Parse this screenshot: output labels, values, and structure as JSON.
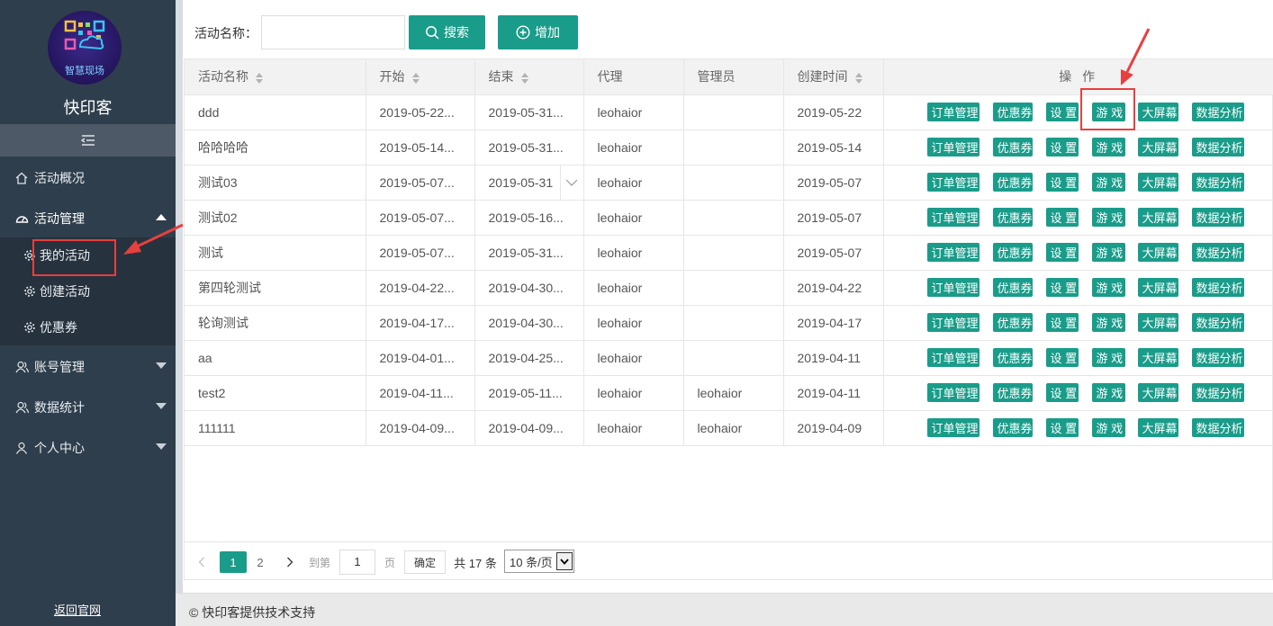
{
  "app": {
    "brand": "快印客",
    "logo_text": "智慧现场",
    "back_link": "返回官网"
  },
  "sidebar": {
    "items": [
      {
        "label": "活动概况",
        "icon": "home-icon"
      },
      {
        "label": "活动管理",
        "icon": "dashboard-icon"
      },
      {
        "label": "账号管理",
        "icon": "users-icon"
      },
      {
        "label": "数据统计",
        "icon": "users-icon"
      },
      {
        "label": "个人中心",
        "icon": "user-icon"
      }
    ],
    "submenu": [
      {
        "label": "我的活动",
        "icon": "gear-icon"
      },
      {
        "label": "创建活动",
        "icon": "gear-icon"
      },
      {
        "label": "优惠券",
        "icon": "gear-icon"
      }
    ]
  },
  "search": {
    "label": "活动名称：",
    "value": "",
    "placeholder": "",
    "search_button": "搜索",
    "add_button": "增加"
  },
  "table": {
    "headers": [
      "活动名称",
      "开始",
      "结束",
      "代理",
      "管理员",
      "创建时间",
      "操 作"
    ],
    "actions": [
      "订单管理",
      "优惠券",
      "设 置",
      "游 戏",
      "大屏幕",
      "数据分析"
    ],
    "rows": [
      [
        "ddd",
        "2019-05-22...",
        "2019-05-31...",
        "leohaior",
        "",
        "2019-05-22"
      ],
      [
        "哈哈哈哈",
        "2019-05-14...",
        "2019-05-31...",
        "leohaior",
        "",
        "2019-05-14"
      ],
      [
        "测试03",
        "2019-05-07...",
        "2019-05-31",
        "leohaior",
        "",
        "2019-05-07"
      ],
      [
        "测试02",
        "2019-05-07...",
        "2019-05-16...",
        "leohaior",
        "",
        "2019-05-07"
      ],
      [
        "测试",
        "2019-05-07...",
        "2019-05-31...",
        "leohaior",
        "",
        "2019-05-07"
      ],
      [
        "第四轮测试",
        "2019-04-22...",
        "2019-04-30...",
        "leohaior",
        "",
        "2019-04-22"
      ],
      [
        "轮询测试",
        "2019-04-17...",
        "2019-04-30...",
        "leohaior",
        "",
        "2019-04-17"
      ],
      [
        "aa",
        "2019-04-01...",
        "2019-04-25...",
        "leohaior",
        "",
        "2019-04-11"
      ],
      [
        "test2",
        "2019-04-11...",
        "2019-05-11...",
        "leohaior",
        "leohaior",
        "2019-04-11"
      ],
      [
        "111111",
        "2019-04-09...",
        "2019-04-09...",
        "leohaior",
        "leohaior",
        "2019-04-09"
      ]
    ]
  },
  "pager": {
    "pages": [
      "1",
      "2"
    ],
    "goto_label": "到第",
    "goto_value": "1",
    "page_label": "页",
    "confirm": "确定",
    "total": "共 17 条",
    "page_size": "10 条/页"
  },
  "footer": {
    "text": "© 快印客提供技术支持"
  },
  "colors": {
    "sidebar": "#2f3e4c",
    "accent": "#1a9c8a",
    "annotation": "#e83f3f"
  }
}
